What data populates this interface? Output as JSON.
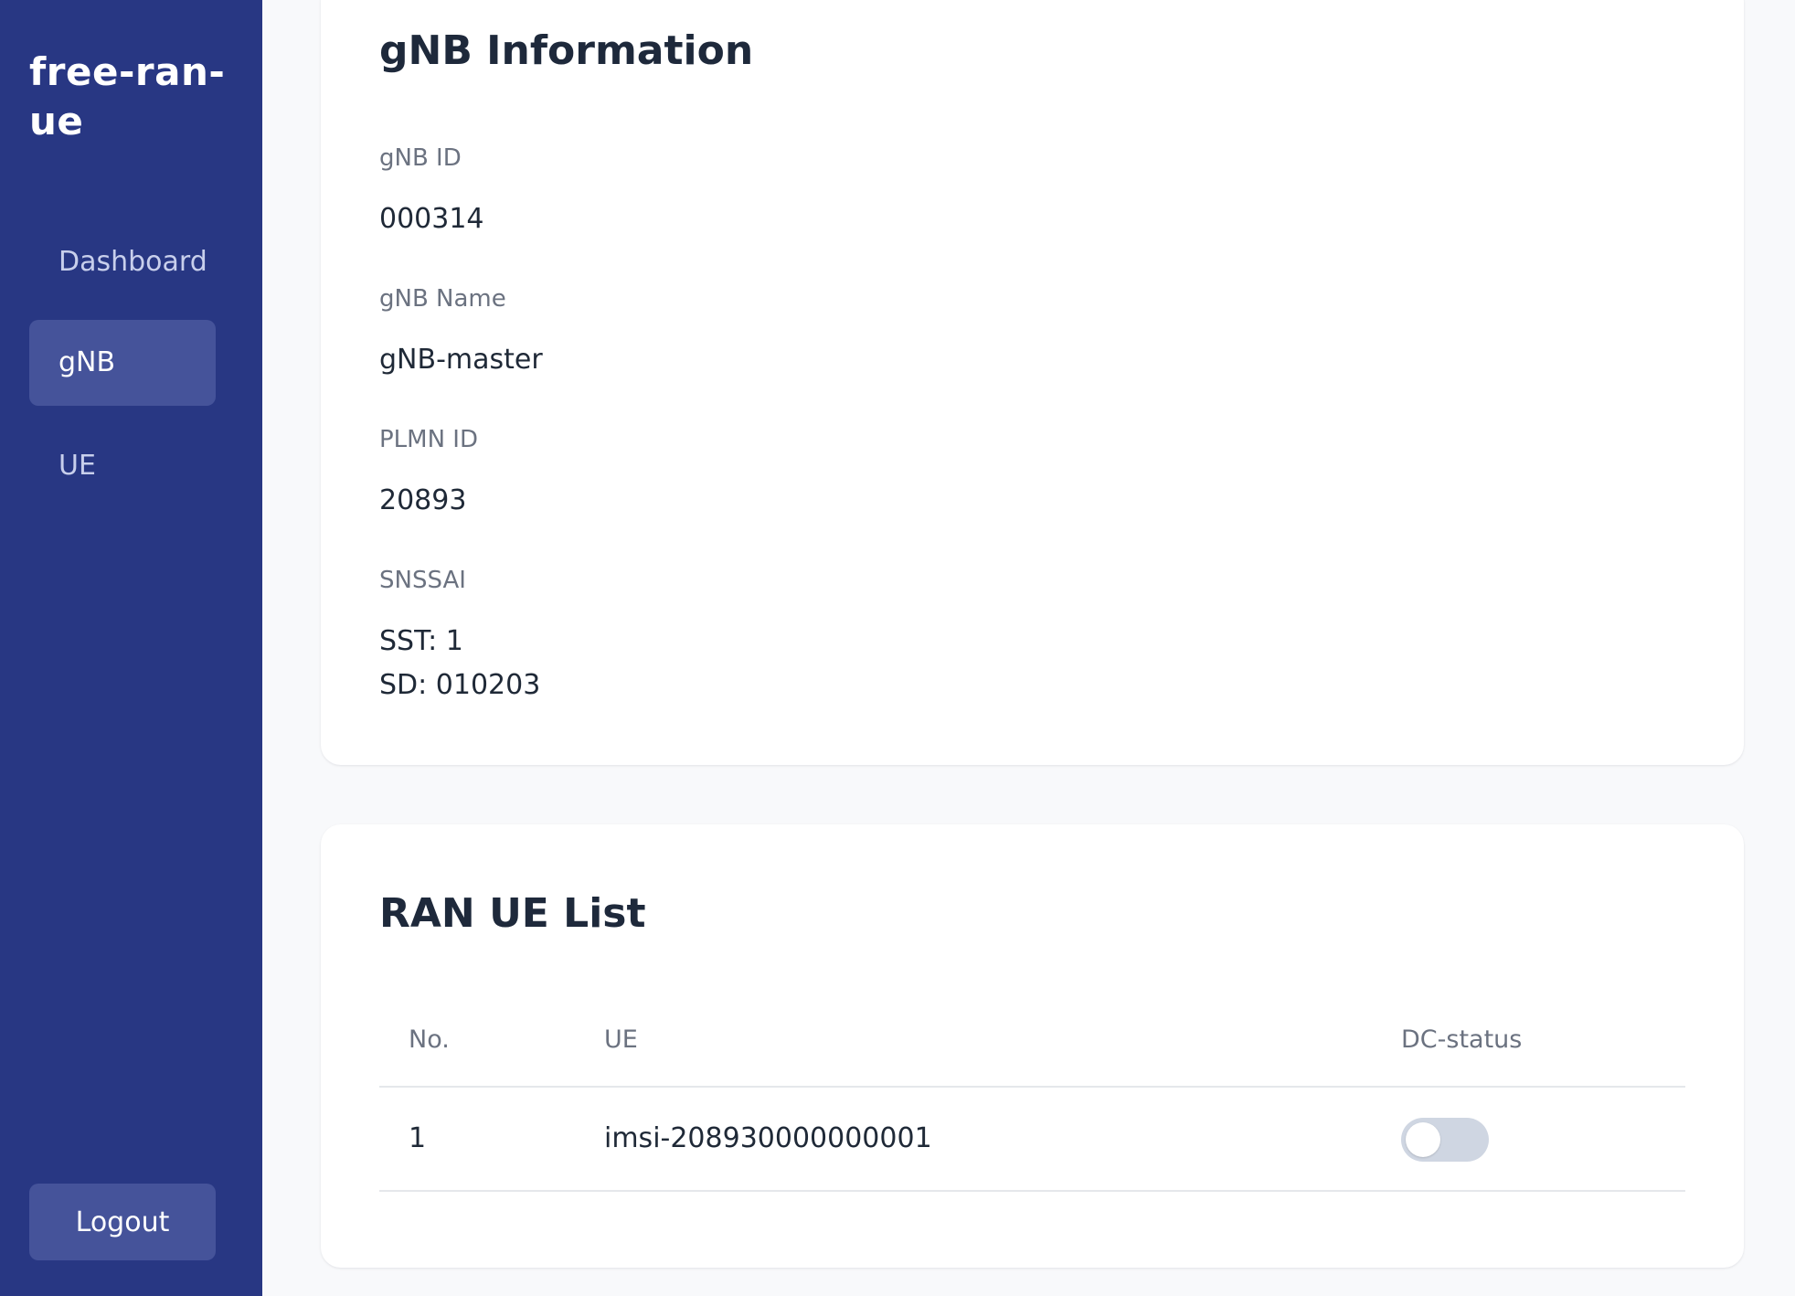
{
  "app": {
    "brand": "free-ran-ue"
  },
  "sidebar": {
    "items": [
      {
        "label": "Dashboard",
        "active": false
      },
      {
        "label": "gNB",
        "active": true
      },
      {
        "label": "UE",
        "active": false
      }
    ],
    "logout_label": "Logout"
  },
  "gnb_info": {
    "title": "gNB Information",
    "fields": {
      "gnb_id": {
        "label": "gNB ID",
        "value": "000314"
      },
      "gnb_name": {
        "label": "gNB Name",
        "value": "gNB-master"
      },
      "plmn_id": {
        "label": "PLMN ID",
        "value": "20893"
      },
      "snssai": {
        "label": "SNSSAI",
        "sst": "SST: 1",
        "sd": "SD: 010203"
      }
    }
  },
  "ue_list": {
    "title": "RAN UE List",
    "columns": [
      "No.",
      "UE",
      "DC-status"
    ],
    "rows": [
      {
        "no": "1",
        "ue": "imsi-208930000000001",
        "dc_status": false
      }
    ]
  },
  "colors": {
    "sidebar_bg": "#283783",
    "sidebar_active": "#45539a",
    "page_bg": "#f8f9fb",
    "toggle_off": "#cfd6e2"
  },
  "icons": {
    "toggle": "switch-toggle-off"
  }
}
